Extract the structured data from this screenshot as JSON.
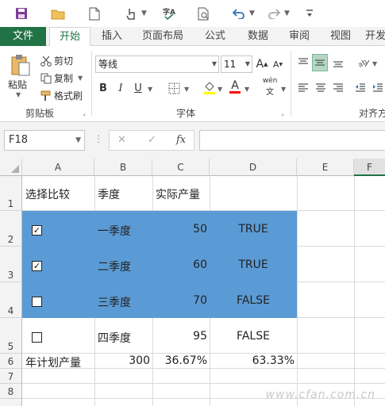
{
  "quick_access": {
    "save_icon": "save-icon",
    "open_icon": "folder-icon",
    "new_icon": "new-file-icon",
    "touch_icon": "touch-mode-icon",
    "spelling_icon": "spell-check-icon",
    "preview_icon": "print-preview-icon",
    "undo_icon": "undo-icon",
    "redo_icon": "redo-icon",
    "customize_icon": "customize-icon"
  },
  "tabs": [
    "文件",
    "开始",
    "插入",
    "页面布局",
    "公式",
    "数据",
    "审阅",
    "视图",
    "开发"
  ],
  "ribbon": {
    "clipboard": {
      "paste": "粘贴",
      "cut": "剪切",
      "copy": "复制",
      "format_painter": "格式刷",
      "label": "剪贴板"
    },
    "font": {
      "name": "等线",
      "size": "11",
      "label": "字体",
      "bold": "B",
      "italic": "I",
      "underline": "U",
      "phonetic": "wén"
    },
    "alignment": {
      "label": "对齐方"
    },
    "colors": {
      "accent": "#217346",
      "fill": "#ffff00",
      "font": "#ff0000"
    }
  },
  "formula_bar": {
    "name_box": "F18",
    "cancel": "✕",
    "enter": "✓",
    "function": "fx",
    "value": ""
  },
  "columns": [
    "A",
    "B",
    "C",
    "D",
    "E",
    "F"
  ],
  "rows": [
    "1",
    "2",
    "3",
    "4",
    "5",
    "6",
    "7",
    "8"
  ],
  "cells": {
    "header": {
      "a": "选择比较",
      "b": "季度",
      "c": "实际产量"
    },
    "data": [
      {
        "checked": true,
        "quarter": "一季度",
        "value": "50",
        "flag": "TRUE"
      },
      {
        "checked": true,
        "quarter": "二季度",
        "value": "60",
        "flag": "TRUE"
      },
      {
        "checked": false,
        "quarter": "三季度",
        "value": "70",
        "flag": "FALSE"
      },
      {
        "checked": false,
        "quarter": "四季度",
        "value": "95",
        "flag": "FALSE"
      }
    ],
    "summary": {
      "label": "年计划产量",
      "plan": "300",
      "pct1": "36.67%",
      "pct2": "63.33%"
    }
  },
  "selection_color": "#5b9bd5",
  "watermark": "www.cfan.com.cn"
}
